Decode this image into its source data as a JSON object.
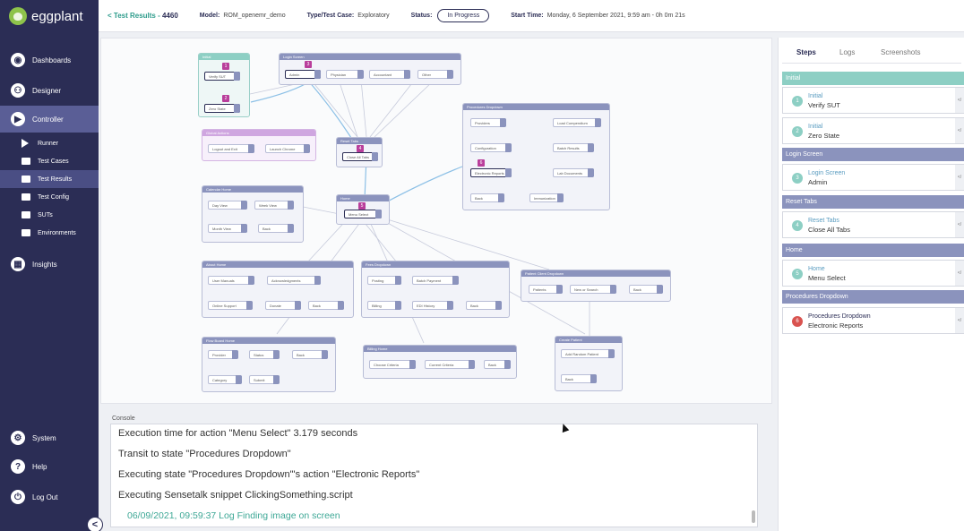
{
  "app": {
    "logo_text": "eggplant"
  },
  "sidebar": {
    "items": [
      {
        "label": "Dashboards",
        "icon": "dashboard-icon"
      },
      {
        "label": "Designer",
        "icon": "designer-icon"
      },
      {
        "label": "Controller",
        "icon": "controller-icon",
        "active": true
      },
      {
        "label": "Runner",
        "icon": "play-icon"
      },
      {
        "label": "Test Cases",
        "icon": "test-cases-icon"
      },
      {
        "label": "Test Results",
        "icon": "test-results-icon",
        "active": true
      },
      {
        "label": "Test Config",
        "icon": "test-config-icon"
      },
      {
        "label": "SUTs",
        "icon": "monitor-icon"
      },
      {
        "label": "Environments",
        "icon": "environments-icon"
      },
      {
        "label": "Insights",
        "icon": "insights-icon"
      },
      {
        "label": "System",
        "icon": "system-icon"
      },
      {
        "label": "Help",
        "icon": "help-icon"
      },
      {
        "label": "Log Out",
        "icon": "logout-icon"
      }
    ],
    "collapse_glyph": "<"
  },
  "header": {
    "back_text": "< Test Results - ",
    "result_id": "4460",
    "model_label": "Model:",
    "model_value": "ROM_openemr_demo",
    "type_label": "Type/Test Case:",
    "type_value": "Exploratory",
    "status_label": "Status:",
    "status_value": "In Progress",
    "start_label": "Start Time:",
    "start_value": "Monday, 6 September 2021, 9:59 am - 0h 0m 21s"
  },
  "flow": {
    "initial": {
      "title": "Initial",
      "nodes": [
        "Verify SUT",
        "Zero State"
      ]
    },
    "login": {
      "title": "Login Screen",
      "nodes": [
        "Admin",
        "Physician",
        "Accountant",
        "Other"
      ]
    },
    "global_actions": {
      "title": "Global Actions",
      "nodes": [
        "Logout and Exit",
        "Launch Chrome"
      ]
    },
    "reset_tabs": {
      "title": "Reset Tabs",
      "nodes": [
        "Close All Tabs"
      ]
    },
    "procedures": {
      "title": "Procedures Dropdown",
      "nodes": [
        "Providers",
        "Load Compendium",
        "Configuration",
        "Batch Results",
        "Electronic Reports",
        "Lab Documents",
        "Back",
        "Immunization"
      ]
    },
    "calendar": {
      "title": "Calendar Home",
      "nodes": [
        "Day View",
        "Week View",
        "Month View",
        "Back"
      ]
    },
    "home": {
      "title": "Home",
      "nodes": [
        "Menu Select"
      ]
    },
    "about": {
      "title": "About Home",
      "nodes": [
        "User Manuals",
        "Acknowledgments",
        "Online Support",
        "Donate",
        "Back"
      ]
    },
    "fees": {
      "title": "Fees Dropdown",
      "nodes": [
        "Posting",
        "Batch Payment",
        "Billing",
        "EDI History",
        "Back"
      ]
    },
    "patient_client": {
      "title": "Patient Client Dropdown",
      "nodes": [
        "Patients",
        "New or Search",
        "Back"
      ]
    },
    "flow_board": {
      "title": "Flow Board Home",
      "nodes": [
        "Provider",
        "Status",
        "Back",
        "Category",
        "Submit"
      ]
    },
    "billing": {
      "title": "Billing Home",
      "nodes": [
        "Choose Criteria",
        "Current Criteria",
        "Back"
      ]
    },
    "create_patient": {
      "title": "Create Patient",
      "nodes": [
        "Add Random Patient",
        "Back"
      ]
    },
    "step_numbers": [
      "1",
      "2",
      "3",
      "4",
      "5",
      "6"
    ]
  },
  "console": {
    "label": "Console",
    "lines": [
      "Execution time for action \"Menu Select\" 3.179 seconds",
      "Transit to state \"Procedures Dropdown\"",
      "Executing state \"Procedures Dropdown\"'s action \"Electronic Reports\"",
      "Executing Sensetalk snippet ClickingSomething.script"
    ],
    "log_line": "06/09/2021, 09:59:37 Log Finding image on screen"
  },
  "right_panel": {
    "tabs": [
      "Steps",
      "Logs",
      "Screenshots"
    ],
    "groups": [
      {
        "title": "Initial",
        "color": "#8dcfc4",
        "steps": [
          {
            "num": "1",
            "state": "Initial",
            "action": "Verify SUT",
            "color": "#8dcfc4"
          },
          {
            "num": "2",
            "state": "Initial",
            "action": "Zero State",
            "color": "#8dcfc4"
          }
        ]
      },
      {
        "title": "Login Screen",
        "color": "#8b93bd",
        "steps": [
          {
            "num": "3",
            "state": "Login Screen",
            "action": "Admin",
            "color": "#8dcfc4"
          }
        ]
      },
      {
        "title": "Reset Tabs",
        "color": "#8b93bd",
        "steps": [
          {
            "num": "4",
            "state": "Reset Tabs",
            "action": "Close All Tabs",
            "color": "#8dcfc4"
          }
        ]
      },
      {
        "title": "Home",
        "color": "#8b93bd",
        "steps": [
          {
            "num": "5",
            "state": "Home",
            "action": "Menu Select",
            "color": "#8dcfc4"
          }
        ]
      },
      {
        "title": "Procedures Dropdown",
        "color": "#8b93bd",
        "steps": [
          {
            "num": "6",
            "state": "Procedures Dropdown",
            "action": "Electronic Reports",
            "color": "#d9534f"
          }
        ]
      }
    ],
    "code_glyph": "</"
  },
  "colors": {
    "sidebar_bg": "#2b2d55",
    "accent_teal": "#8dcfc4",
    "accent_navy": "#8b93bd",
    "error_red": "#d9534f",
    "highlight_magenta": "#b93e9b"
  }
}
